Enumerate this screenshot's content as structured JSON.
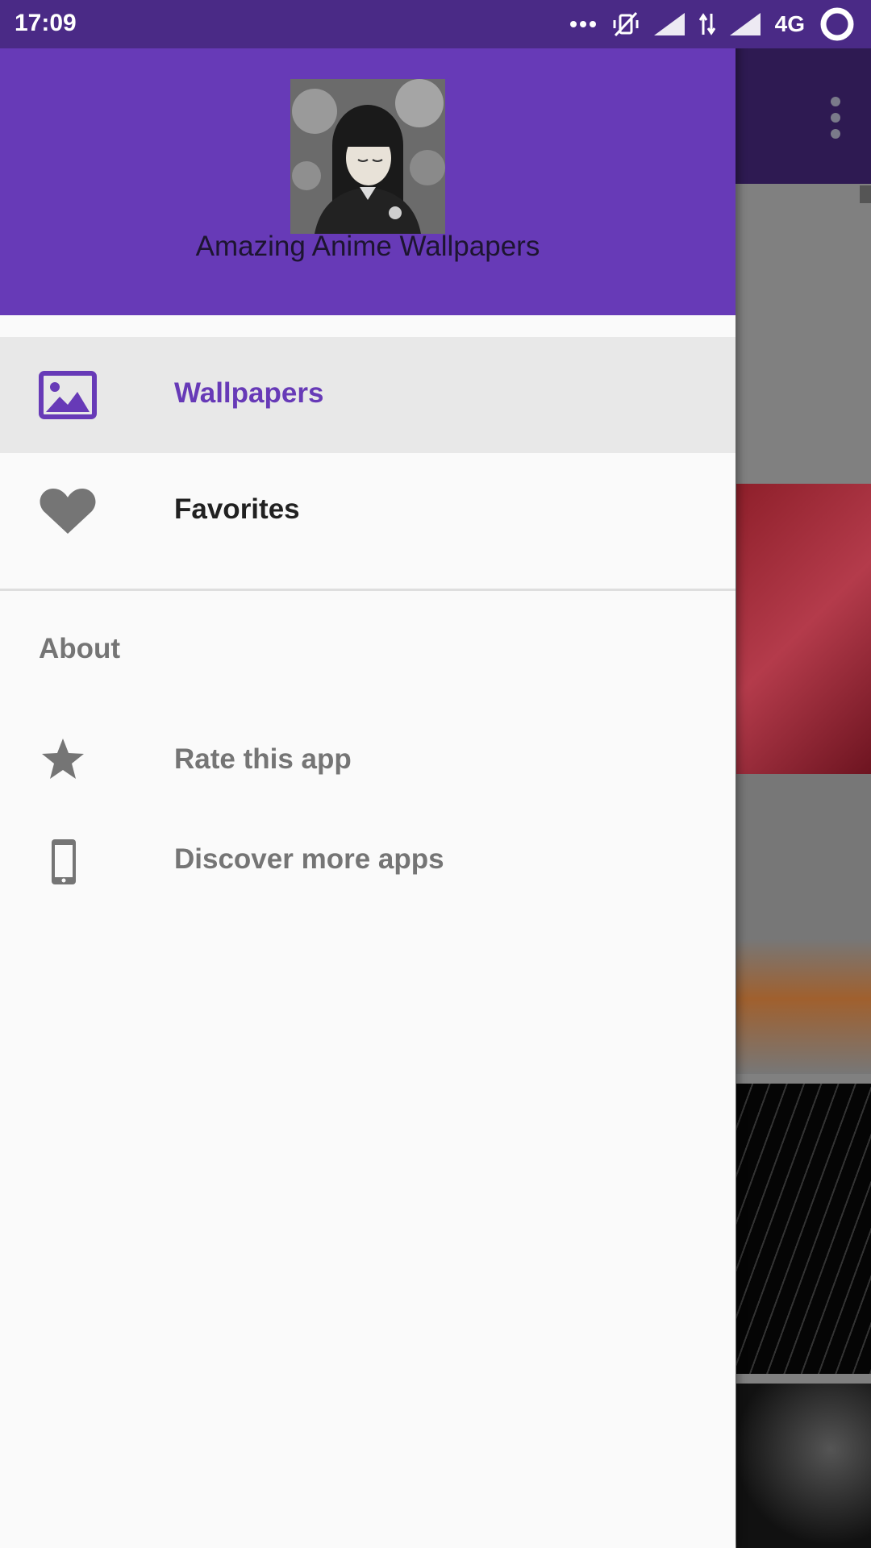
{
  "status_bar": {
    "time": "17:09",
    "network": "4G",
    "icons": [
      "more-dots-icon",
      "vibrate-off-icon",
      "signal-icon",
      "data-arrows-icon",
      "signal-icon",
      "loading-ring-icon"
    ]
  },
  "drawer": {
    "app_title": "Amazing Anime Wallpapers",
    "header_color": "#673ab7",
    "items": [
      {
        "label": "Wallpapers",
        "icon": "image-icon",
        "selected": true
      },
      {
        "label": "Favorites",
        "icon": "heart-icon",
        "selected": false
      }
    ],
    "section_title": "About",
    "about_items": [
      {
        "label": "Rate this app",
        "icon": "star-icon"
      },
      {
        "label": "Discover more apps",
        "icon": "phone-icon"
      }
    ]
  },
  "colors": {
    "accent": "#673ab7",
    "selected_text": "#673ab7",
    "primary_text": "#212121",
    "secondary_text": "#757575"
  }
}
